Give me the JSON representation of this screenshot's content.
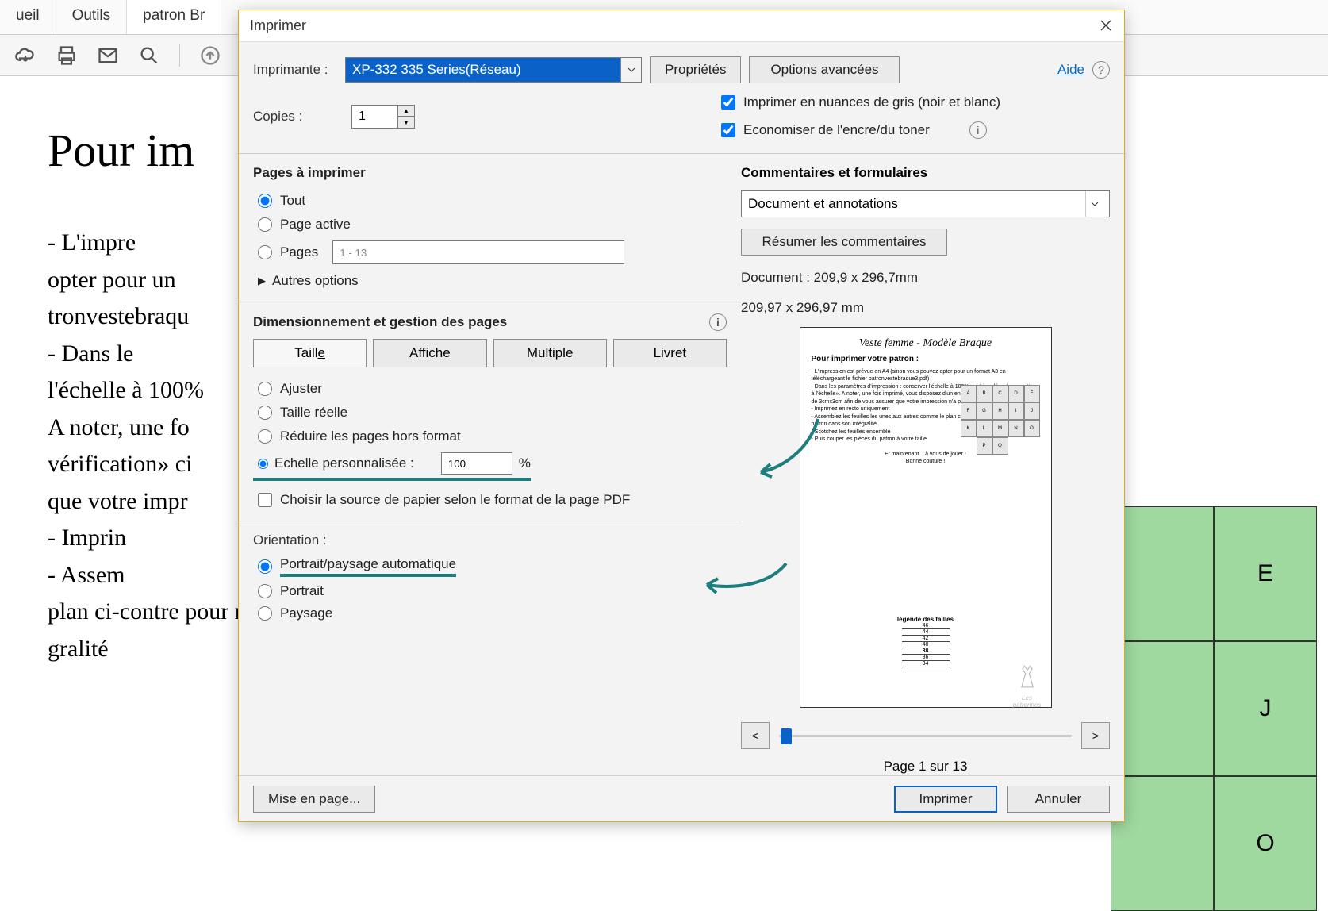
{
  "tabs": {
    "home": "ueil",
    "tools": "Outils",
    "file": "patron Br"
  },
  "doc": {
    "heading": "Pour im",
    "body": "- L'impre\nopter pour un \ntronvestebraqu\n- Dans le\nl'échelle à 100%\nA noter, une fo\nvérification» ci\nque votre impr\n- Imprin\n- Assem\nplan ci-contre pour reconstituer le patron dans son inté-\ngralité"
  },
  "green_cells": [
    "E",
    "J",
    "O"
  ],
  "dialog": {
    "title": "Imprimer",
    "printer_label": "Imprimante :",
    "printer_value": "XP-332 335 Series(Réseau)",
    "properties": "Propriétés",
    "advanced": "Options avancées",
    "help": "Aide",
    "copies_label": "Copies :",
    "copies_value": "1",
    "grayscale": "Imprimer en nuances de gris (noir et blanc)",
    "saveink": "Economiser de l'encre/du toner",
    "pages": {
      "title": "Pages à imprimer",
      "all": "Tout",
      "current": "Page active",
      "pages_label": "Pages",
      "pages_range": "1 - 13",
      "more": "Autres options"
    },
    "sizing": {
      "title": "Dimensionnement et gestion des pages",
      "size": "Taille",
      "poster": "Affiche",
      "multiple": "Multiple",
      "booklet": "Livret",
      "fit": "Ajuster",
      "actual": "Taille réelle",
      "shrink": "Réduire les pages hors format",
      "custom": "Echelle personnalisée :",
      "custom_value": "100",
      "percent": "%",
      "paper_source": "Choisir la source de papier selon le format de la page PDF"
    },
    "orientation": {
      "title": "Orientation :",
      "auto": "Portrait/paysage automatique",
      "portrait": "Portrait",
      "landscape": "Paysage"
    },
    "comments": {
      "title": "Commentaires et formulaires",
      "select_value": "Document et annotations",
      "summarize": "Résumer les commentaires"
    },
    "preview": {
      "docline": "Document : 209,9 x 296,7mm",
      "pageline": "209,97 x 296,97 mm",
      "page_indicator": "Page 1 sur 13",
      "mini_title": "Veste femme - Modèle Braque",
      "mini_sub": "Pour imprimer votre patron :",
      "legend_title": "légende des tailles",
      "legend_rows": [
        "46",
        "44",
        "42",
        "40",
        "38",
        "36",
        "34"
      ],
      "mini_cells": [
        [
          "A",
          "B",
          "C",
          "D",
          "E"
        ],
        [
          "F",
          "G",
          "H",
          "I",
          "J"
        ],
        [
          "K",
          "L",
          "M",
          "N",
          "O"
        ],
        [
          "",
          "P",
          "Q",
          "",
          ""
        ]
      ],
      "signature": "Les patronnes"
    },
    "footer": {
      "pagesetup": "Mise en page...",
      "print": "Imprimer",
      "cancel": "Annuler"
    }
  }
}
